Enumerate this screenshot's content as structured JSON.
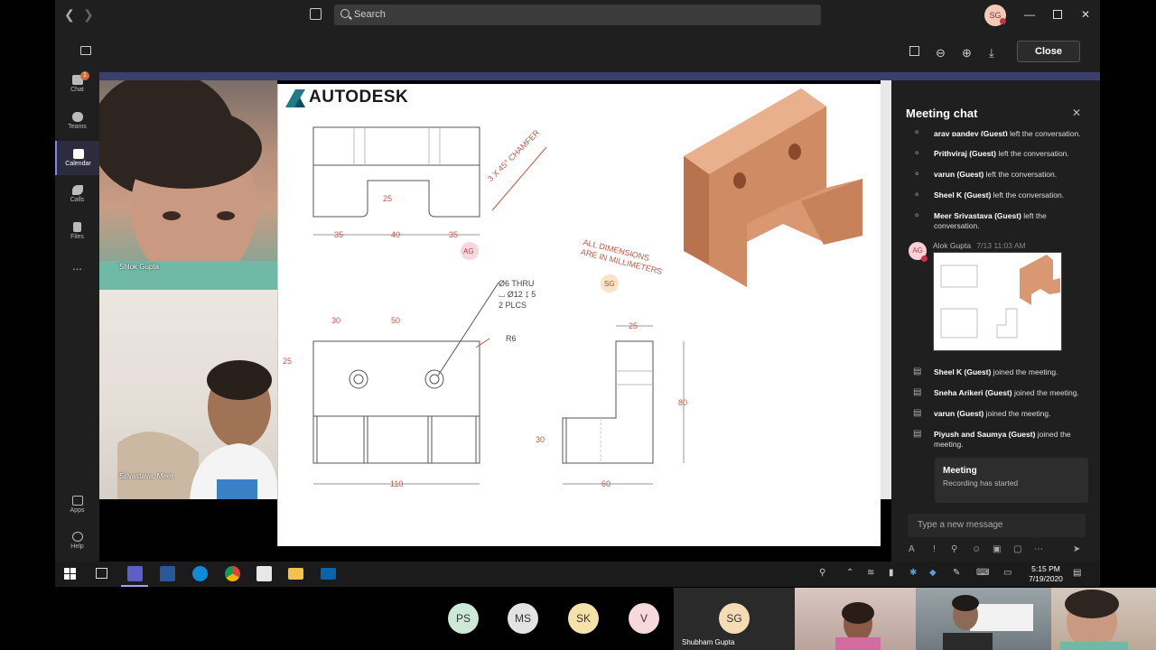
{
  "topbar": {
    "search_placeholder": "Search",
    "user_initials": "SG"
  },
  "rail": {
    "chat_badge": "1",
    "items": [
      {
        "label": "Chat"
      },
      {
        "label": "Teams"
      },
      {
        "label": "Calendar"
      },
      {
        "label": "Calls"
      },
      {
        "label": "Files"
      },
      {
        "label": "..."
      },
      {
        "label": "Apps"
      },
      {
        "label": "Help"
      }
    ]
  },
  "stage": {
    "close_label": "Close"
  },
  "videos": {
    "tile1_name": "Shlok Gupta",
    "tile2_name": "Srivastava, Meer"
  },
  "slide": {
    "logo": "AUTODESK",
    "chamfer_note": "3 X 45° CHAMFER",
    "dims_note_line1": "ALL DIMENSIONS",
    "dims_note_line2": "ARE IN MILLIMETERS",
    "hole_note_line1": "Ø6 THRU",
    "hole_note_line2": "⌴ Ø12 ↧ 5",
    "hole_note_line3": "2 PLCS",
    "radius_note": "R6",
    "dims": {
      "top_h": "25",
      "top_a": "35",
      "top_b": "40",
      "top_c": "35",
      "front_a": "30",
      "front_b": "50",
      "front_h": "25",
      "front_w": "110",
      "side_t": "25",
      "side_h": "80",
      "side_l": "30",
      "side_w": "60"
    },
    "cursor_badges": [
      "AG",
      "SG"
    ]
  },
  "chat": {
    "title": "Meeting chat",
    "events_top": [
      {
        "name": "arav pandey (Guest)",
        "text": " left the conversation."
      },
      {
        "name": "Prithviraj (Guest)",
        "text": " left the conversation."
      },
      {
        "name": "varun (Guest)",
        "text": " left the conversation."
      },
      {
        "name": "Sheel K (Guest)",
        "text": " left the conversation."
      },
      {
        "name": "Meer Srivastava (Guest)",
        "text": " left the conversation."
      }
    ],
    "message": {
      "avatar": "AG",
      "author": "Alok Gupta",
      "time": "7/13 11:03 AM"
    },
    "events_bottom": [
      {
        "name": "Sheel K (Guest)",
        "text": " joined the meeting."
      },
      {
        "name": "Sneha Arikeri (Guest)",
        "text": " joined the meeting."
      },
      {
        "name": "varun (Guest)",
        "text": " joined the meeting."
      },
      {
        "name": "Piyush and Saumya (Guest)",
        "text": " joined the meeting."
      }
    ],
    "card_title": "Meeting",
    "card_sub": "Recording has started",
    "compose_placeholder": "Type a new message"
  },
  "taskbar": {
    "time": "5:15 PM",
    "date": "7/19/2020"
  },
  "participants": {
    "chips": [
      "PS",
      "MS",
      "SK",
      "V",
      "SG"
    ],
    "chip_colors": [
      "#cde8d7",
      "#e3e3e3",
      "#f5e2a8",
      "#f7d9db",
      "#f5dcb5"
    ],
    "sg_name": "Shubham Gupta"
  }
}
